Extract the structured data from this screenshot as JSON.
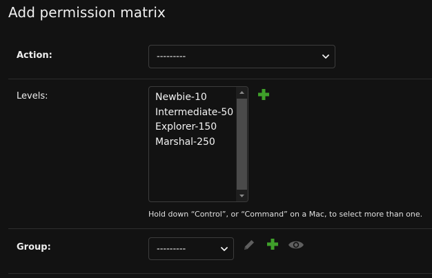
{
  "page": {
    "title": "Add permission matrix"
  },
  "form": {
    "action": {
      "label": "Action:",
      "value": "---------"
    },
    "levels": {
      "label": "Levels:",
      "options": [
        "Newbie-10",
        "Intermediate-50",
        "Explorer-150",
        "Marshal-250"
      ],
      "help_text": "Hold down “Control”, or “Command” on a Mac, to select more than one."
    },
    "group": {
      "label": "Group:",
      "value": "---------"
    }
  },
  "icons": {
    "add": "plus-icon",
    "change": "pencil-icon",
    "view": "eye-icon",
    "dropdown": "chevron-down-icon"
  },
  "colors": {
    "background": "#121212",
    "add_green": "#3fa02a",
    "muted_icon": "#5f5f5f",
    "border": "#3d3d3d"
  }
}
